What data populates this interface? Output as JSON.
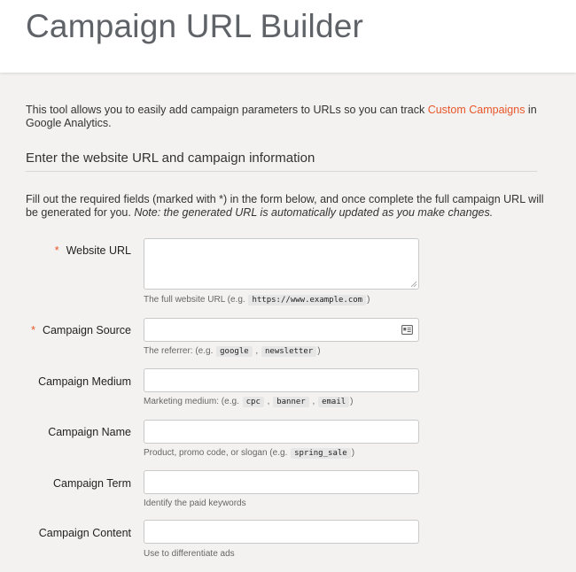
{
  "header": {
    "title": "Campaign URL Builder"
  },
  "intro": {
    "text_before": "This tool allows you to easily add campaign parameters to URLs so you can track ",
    "link": "Custom Campaigns",
    "text_after": " in Google Analytics."
  },
  "section": {
    "title": "Enter the website URL and campaign information"
  },
  "instructions": {
    "text": "Fill out the required fields (marked with *) in the form below, and once complete the full campaign URL will be generated for you. ",
    "note": "Note: the generated URL is automatically updated as you make changes."
  },
  "required_marker": "*",
  "fields": {
    "website_url": {
      "label": "Website URL",
      "value": "",
      "placeholder": "",
      "help_before": "The full website URL (e.g. ",
      "help_code": [
        "https://www.example.com"
      ],
      "help_after": ")"
    },
    "campaign_source": {
      "label": "Campaign Source",
      "value": "",
      "placeholder": "",
      "help_before": "The referrer: (e.g. ",
      "help_code": [
        "google",
        "newsletter"
      ],
      "help_after": ")"
    },
    "campaign_medium": {
      "label": "Campaign Medium",
      "value": "",
      "placeholder": "",
      "help_before": "Marketing medium: (e.g. ",
      "help_code": [
        "cpc",
        "banner",
        "email"
      ],
      "help_after": ")"
    },
    "campaign_name": {
      "label": "Campaign Name",
      "value": "",
      "placeholder": "",
      "help_before": "Product, promo code, or slogan (e.g. ",
      "help_code": [
        "spring_sale"
      ],
      "help_after": ")"
    },
    "campaign_term": {
      "label": "Campaign Term",
      "value": "",
      "placeholder": "",
      "help_before": "Identify the paid keywords"
    },
    "campaign_content": {
      "label": "Campaign Content",
      "value": "",
      "placeholder": "",
      "help_before": "Use to differentiate ads"
    }
  },
  "separator": " , ",
  "icons": {
    "source_picker": "contact-card-icon",
    "resize": "resize-grip-icon"
  },
  "colors": {
    "accent": "#e8562a",
    "background": "#f3f2f1",
    "header_bg": "#ffffff"
  }
}
